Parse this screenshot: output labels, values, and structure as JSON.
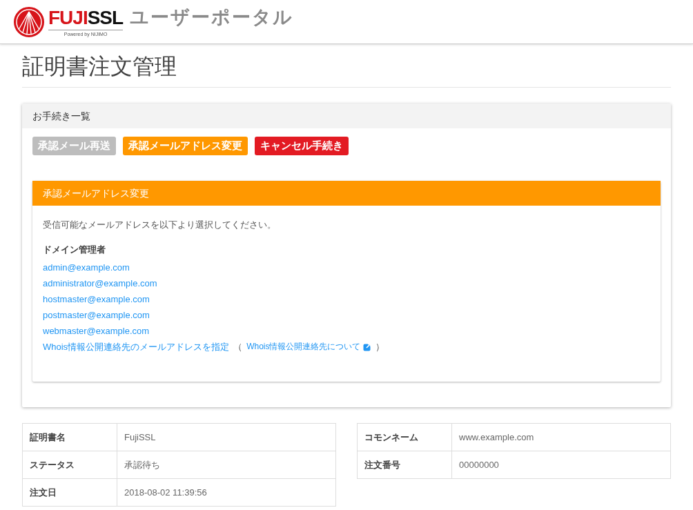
{
  "header": {
    "logo_red": "FUJI",
    "logo_black": "SSL",
    "logo_sub": "Powered by NIJIMO",
    "portal_title": "ユーザーポータル"
  },
  "page_title": "証明書注文管理",
  "procedures": {
    "title": "お手続き一覧",
    "buttons": [
      {
        "label": "承認メール再送",
        "color": "#bdbdbd"
      },
      {
        "label": "承認メールアドレス変更",
        "color": "#ff9800"
      },
      {
        "label": "キャンセル手続き",
        "color": "#e31b23"
      }
    ],
    "panel": {
      "title": "承認メールアドレス変更",
      "instruction": "受信可能なメールアドレスを以下より選択してください。",
      "group_label": "ドメイン管理者",
      "emails": [
        "admin@example.com",
        "administrator@example.com",
        "hostmaster@example.com",
        "postmaster@example.com",
        "webmaster@example.com"
      ],
      "whois_link": "Whois情報公開連絡先のメールアドレスを指定",
      "paren_open": "（",
      "whois_info_link": "Whois情報公開連絡先について",
      "paren_close": "）"
    }
  },
  "details_left": [
    {
      "label": "証明書名",
      "value": "FujiSSL"
    },
    {
      "label": "ステータス",
      "value": "承認待ち"
    },
    {
      "label": "注文日",
      "value": "2018-08-02 11:39:56"
    }
  ],
  "details_right": [
    {
      "label": "コモンネーム",
      "value": "www.example.com"
    },
    {
      "label": "注文番号",
      "value": "00000000"
    }
  ]
}
